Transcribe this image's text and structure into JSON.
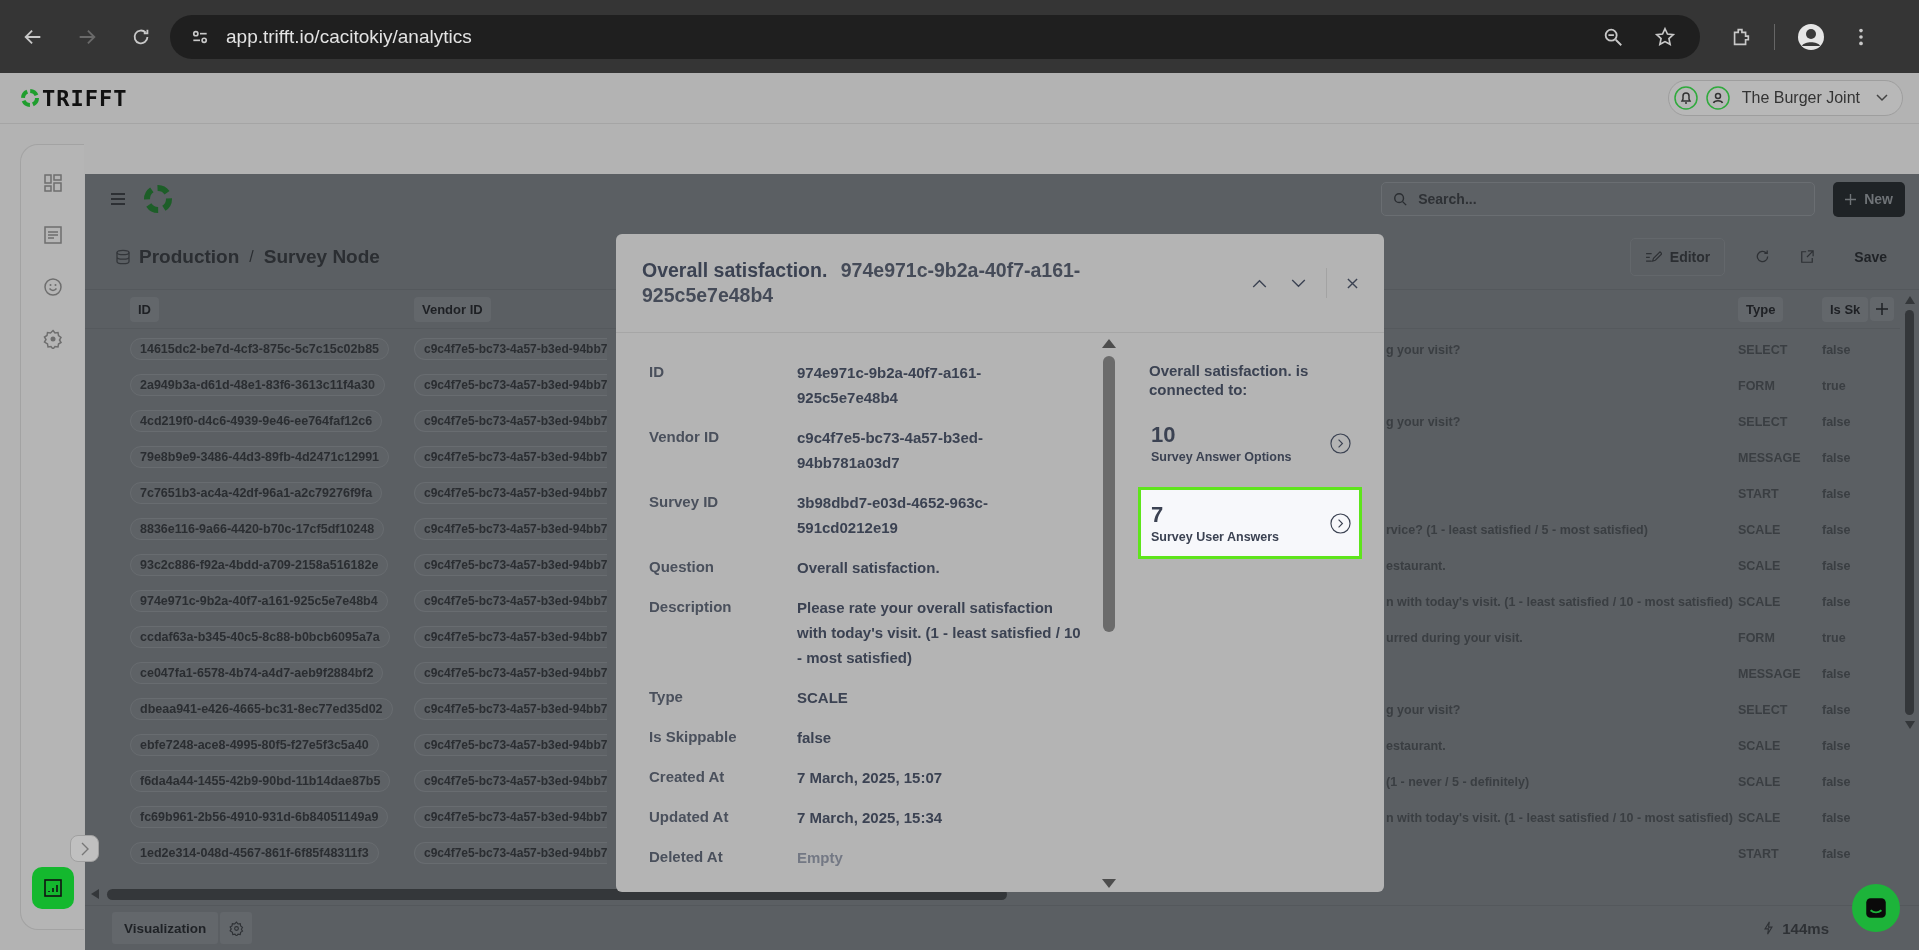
{
  "browser": {
    "url": "app.trifft.io/cacitokiy/analytics",
    "forward_enabled": false
  },
  "app_header": {
    "logo": "TRIFFT",
    "account": "The Burger Joint"
  },
  "sidebar": {
    "items": [
      {
        "kind": "dashboard",
        "selected": false
      },
      {
        "kind": "document",
        "selected": false
      },
      {
        "kind": "smiley",
        "selected": false
      },
      {
        "kind": "settings",
        "selected": false
      },
      {
        "kind": "analytics",
        "selected": true
      }
    ]
  },
  "toolbar": {
    "search_placeholder": "Search...",
    "new_button": "New"
  },
  "breadcrumb": {
    "items": [
      "Production",
      "Survey Node"
    ],
    "separator": "/"
  },
  "actions": {
    "editor": "Editor",
    "save": "Save"
  },
  "table": {
    "columns": [
      {
        "label": "ID"
      },
      {
        "label": "Vendor ID"
      },
      {
        "label": "Type"
      },
      {
        "label": "Is Sk"
      }
    ],
    "rows": [
      {
        "id": "14615dc2-be7d-4cf3-875c-5c7c15c02b85",
        "vendor_id": "c9c4f7e5-bc73-4a57-b3ed-94bb7",
        "column_3": "g your visit?",
        "type": "SELECT",
        "is_skippable": "false"
      },
      {
        "id": "2a949b3a-d61d-48e1-83f6-3613c11f4a30",
        "vendor_id": "c9c4f7e5-bc73-4a57-b3ed-94bb7",
        "type": "FORM",
        "is_skippable": "true"
      },
      {
        "id": "4cd219f0-d4c6-4939-9e46-ee764faf12c6",
        "vendor_id": "c9c4f7e5-bc73-4a57-b3ed-94bb7",
        "column_3": "g your visit?",
        "type": "SELECT",
        "is_skippable": "false"
      },
      {
        "id": "79e8b9e9-3486-44d3-89fb-4d2471c12991",
        "vendor_id": "c9c4f7e5-bc73-4a57-b3ed-94bb7",
        "type": "MESSAGE",
        "is_skippable": "false"
      },
      {
        "id": "7c7651b3-ac4a-42df-96a1-a2c79276f9fa",
        "vendor_id": "c9c4f7e5-bc73-4a57-b3ed-94bb7",
        "type": "START",
        "is_skippable": "false"
      },
      {
        "id": "8836e116-9a66-4420-b70c-17cf5df10248",
        "vendor_id": "c9c4f7e5-bc73-4a57-b3ed-94bb7",
        "column_3": "rvice? (1 - least satisfied / 5 - most satisfied)",
        "type": "SCALE",
        "is_skippable": "false"
      },
      {
        "id": "93c2c886-f92a-4bdd-a709-2158a516182e",
        "vendor_id": "c9c4f7e5-bc73-4a57-b3ed-94bb7",
        "column_3": "estaurant.",
        "type": "SCALE",
        "is_skippable": "false"
      },
      {
        "id": "974e971c-9b2a-40f7-a161-925c5e7e48b4",
        "vendor_id": "c9c4f7e5-bc73-4a57-b3ed-94bb7",
        "column_3": "n with today's visit. (1 - least satisfied / 10 - most satisfied)",
        "type": "SCALE",
        "is_skippable": "false"
      },
      {
        "id": "ccdaf63a-b345-40c5-8c88-b0bcb6095a7a",
        "vendor_id": "c9c4f7e5-bc73-4a57-b3ed-94bb7",
        "column_3": "urred during your visit.",
        "type": "FORM",
        "is_skippable": "true"
      },
      {
        "id": "ce047fa1-6578-4b74-a4d7-aeb9f2884bf2",
        "vendor_id": "c9c4f7e5-bc73-4a57-b3ed-94bb7",
        "type": "MESSAGE",
        "is_skippable": "false"
      },
      {
        "id": "dbeaa941-e426-4665-bc31-8ec77ed35d02",
        "vendor_id": "c9c4f7e5-bc73-4a57-b3ed-94bb7",
        "column_3": "g your visit?",
        "type": "SELECT",
        "is_skippable": "false"
      },
      {
        "id": "ebfe7248-ace8-4995-80f5-f27e5f3c5a40",
        "vendor_id": "c9c4f7e5-bc73-4a57-b3ed-94bb7",
        "column_3": "estaurant.",
        "type": "SCALE",
        "is_skippable": "false"
      },
      {
        "id": "f6da4a44-1455-42b9-90bd-11b14dae87b5",
        "vendor_id": "c9c4f7e5-bc73-4a57-b3ed-94bb7",
        "column_3": "(1 - never / 5 - definitely)",
        "type": "SCALE",
        "is_skippable": "false"
      },
      {
        "id": "fc69b961-2b56-4910-931d-6b84051149a9",
        "vendor_id": "c9c4f7e5-bc73-4a57-b3ed-94bb7",
        "column_3": "n with today's visit. (1 - least satisfied / 10 - most satisfied)",
        "type": "SCALE",
        "is_skippable": "false"
      },
      {
        "id": "1ed2e314-048d-4567-861f-6f85f48311f3",
        "vendor_id": "c9c4f7e5-bc73-4a57-b3ed-94bb7",
        "type": "START",
        "is_skippable": "false"
      }
    ]
  },
  "bottom_bar": {
    "visualization": "Visualization",
    "timing": "144ms"
  },
  "modal": {
    "title": "Overall satisfaction.",
    "id": "974e971c-9b2a-40f7-a161-925c5e7e48b4",
    "fields": [
      {
        "label": "ID",
        "value": "974e971c-9b2a-40f7-a161-925c5e7e48b4",
        "empty": false
      },
      {
        "label": "Vendor ID",
        "value": "c9c4f7e5-bc73-4a57-b3ed-94bb781a03d7",
        "empty": false
      },
      {
        "label": "Survey ID",
        "value": "3b98dbd7-e03d-4652-963c-591cd0212e19",
        "empty": false
      },
      {
        "label": "Question",
        "value": "Overall satisfaction.",
        "empty": false
      },
      {
        "label": "Description",
        "value": "Please rate your overall satisfaction with today's visit. (1 - least satisfied / 10 - most satisfied)",
        "empty": false
      },
      {
        "label": "Type",
        "value": "SCALE",
        "empty": false
      },
      {
        "label": "Is Skippable",
        "value": "false",
        "empty": false
      },
      {
        "label": "Created At",
        "value": "7 March, 2025, 15:07",
        "empty": false
      },
      {
        "label": "Updated At",
        "value": "7 March, 2025, 15:34",
        "empty": false
      },
      {
        "label": "Deleted At",
        "value": "Empty",
        "empty": true
      }
    ],
    "connections_heading": "Overall satisfaction. is connected to:",
    "connections": [
      {
        "count": "10",
        "label": "Survey Answer Options",
        "selected": false
      },
      {
        "count": "7",
        "label": "Survey User Answers",
        "selected": true
      }
    ]
  }
}
